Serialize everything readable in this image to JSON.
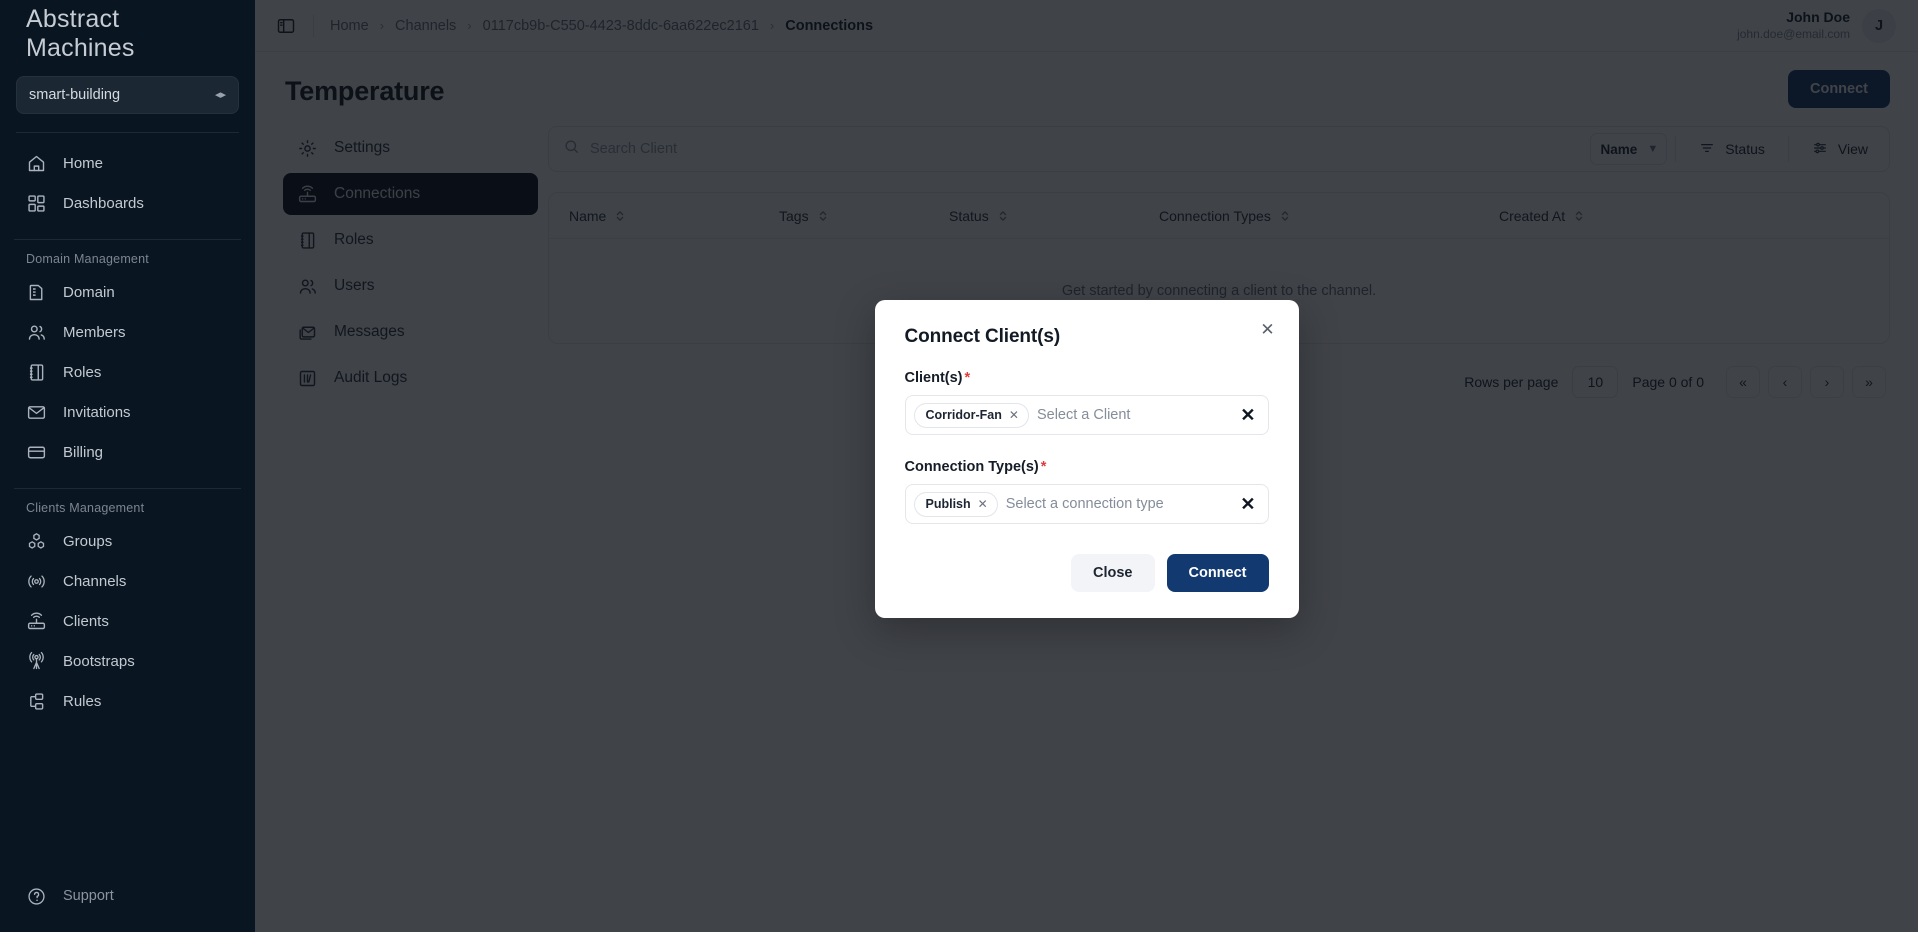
{
  "brand": {
    "name": "Abstract Machines"
  },
  "domain_select": {
    "value": "smart-building",
    "icon": "chevron-updown-icon"
  },
  "sidebar": {
    "groups": [
      {
        "label": "",
        "items": [
          {
            "label": "Home",
            "icon": "home-icon"
          },
          {
            "label": "Dashboards",
            "icon": "dashboards-icon"
          }
        ]
      },
      {
        "label": "Domain Management",
        "items": [
          {
            "label": "Domain",
            "icon": "building-icon"
          },
          {
            "label": "Members",
            "icon": "users-icon"
          },
          {
            "label": "Roles",
            "icon": "notebook-icon"
          },
          {
            "label": "Invitations",
            "icon": "mail-icon"
          },
          {
            "label": "Billing",
            "icon": "credit-card-icon"
          }
        ]
      },
      {
        "label": "Clients Management",
        "items": [
          {
            "label": "Groups",
            "icon": "groups-icon"
          },
          {
            "label": "Channels",
            "icon": "broadcast-icon"
          },
          {
            "label": "Clients",
            "icon": "router-icon"
          },
          {
            "label": "Bootstraps",
            "icon": "antenna-icon"
          },
          {
            "label": "Rules",
            "icon": "rules-icon"
          }
        ]
      }
    ],
    "support": {
      "label": "Support",
      "icon": "help-circle-icon"
    }
  },
  "topbar": {
    "panel_toggle_icon": "sidebar-toggle-icon",
    "breadcrumb": [
      {
        "label": "Home",
        "current": false
      },
      {
        "label": "Channels",
        "current": false
      },
      {
        "label": "0117cb9b-C550-4423-8ddc-6aa622ec2161",
        "current": false
      },
      {
        "label": "Connections",
        "current": true
      }
    ],
    "separator": "›",
    "user": {
      "name": "John Doe",
      "email": "john.doe@email.com",
      "initial": "J"
    }
  },
  "page": {
    "title": "Temperature",
    "tabs": [
      {
        "label": "Settings",
        "icon": "gear-icon",
        "active": false
      },
      {
        "label": "Connections",
        "icon": "router-icon",
        "active": true
      },
      {
        "label": "Roles",
        "icon": "notebook-icon",
        "active": false
      },
      {
        "label": "Users",
        "icon": "users-icon",
        "active": false
      },
      {
        "label": "Messages",
        "icon": "messages-icon",
        "active": false
      },
      {
        "label": "Audit Logs",
        "icon": "audit-icon",
        "active": false
      }
    ],
    "connect_button": "Connect"
  },
  "toolbar": {
    "search_placeholder": "Search Client",
    "search_value": "",
    "search_icon": "search-icon",
    "sort_value": "Name",
    "sort_chevron": "chevron-down-icon",
    "status_button": "Status",
    "status_icon": "filter-icon",
    "view_button": "View",
    "view_icon": "sliders-icon"
  },
  "table": {
    "columns": [
      {
        "label": "Name"
      },
      {
        "label": "Tags"
      },
      {
        "label": "Status"
      },
      {
        "label": "Connection Types"
      },
      {
        "label": "Created At"
      }
    ],
    "empty_message": "Get started by connecting a client to the channel.",
    "rows": []
  },
  "pagination": {
    "rows_per_page_label": "Rows per page",
    "rows_per_page_value": "10",
    "page_label": "Page 0 of 0",
    "first": "«",
    "prev": "‹",
    "next": "›",
    "last": "»"
  },
  "modal": {
    "title": "Connect Client(s)",
    "close_icon": "close-icon",
    "close_glyph": "✕",
    "clients": {
      "label": "Client(s)",
      "required_marker": "*",
      "chips": [
        {
          "label": "Corridor-Fan",
          "remove_glyph": "✕"
        }
      ],
      "placeholder": "Select a Client",
      "clear_glyph": "✕"
    },
    "connection_types": {
      "label": "Connection Type(s)",
      "required_marker": "*",
      "chips": [
        {
          "label": "Publish",
          "remove_glyph": "✕"
        }
      ],
      "placeholder": "Select a connection type",
      "clear_glyph": "✕"
    },
    "close_button": "Close",
    "connect_button": "Connect"
  },
  "colors": {
    "sidebar_bg": "#0a1522",
    "primary": "#123a70",
    "required_red": "#e23b3b",
    "tab_active_bg": "#0a1522"
  }
}
